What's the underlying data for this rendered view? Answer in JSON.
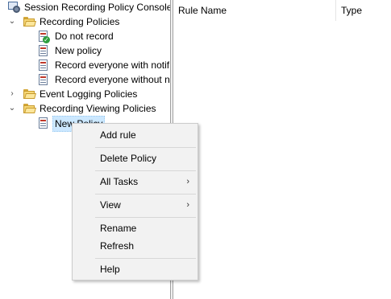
{
  "tree": {
    "root": {
      "label": "Session Recording Policy Console",
      "icon": "console-icon"
    },
    "recording_policies": {
      "label": "Recording Policies",
      "expanded": true,
      "items": [
        {
          "label": "Do not record",
          "icon": "policy-active-icon"
        },
        {
          "label": "New policy",
          "icon": "policy-icon"
        },
        {
          "label": "Record everyone with notif",
          "icon": "policy-icon"
        },
        {
          "label": "Record everyone without n",
          "icon": "policy-icon"
        }
      ]
    },
    "event_logging_policies": {
      "label": "Event Logging Policies",
      "expanded": false
    },
    "recording_viewing_policies": {
      "label": "Recording Viewing Policies",
      "expanded": true,
      "items": [
        {
          "label": "New Policy",
          "icon": "policy-icon",
          "selected": true
        }
      ]
    }
  },
  "list": {
    "columns": [
      "Rule Name",
      "Type"
    ]
  },
  "context_menu": {
    "items": [
      {
        "label": "Add rule"
      },
      {
        "label": "Delete Policy"
      },
      {
        "label": "All Tasks",
        "submenu": true
      },
      {
        "label": "View",
        "submenu": true
      },
      {
        "label": "Rename"
      },
      {
        "label": "Refresh"
      },
      {
        "label": "Help"
      }
    ],
    "submenu_arrow": "›"
  },
  "colors": {
    "selection": "#cce8ff",
    "menu_bg": "#f2f2f2",
    "folder": "#f6d776"
  }
}
